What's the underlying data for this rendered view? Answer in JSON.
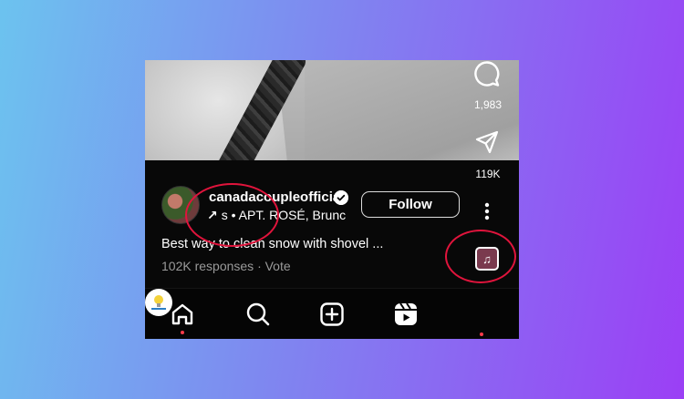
{
  "post": {
    "username": "canadacoupleofficial",
    "music": "s • APT. ROSÉ, Brunc",
    "follow_label": "Follow",
    "caption": "Best way to clean snow with shovel ...",
    "responses": "102K responses · Vote"
  },
  "rail": {
    "comments": "1,983",
    "shares": "119K"
  },
  "nav": {
    "items": [
      "home-icon",
      "search-icon",
      "create-icon",
      "reels-icon",
      "profile-avatar"
    ]
  },
  "colors": {
    "background_start": "#6cc3ef",
    "background_end": "#9b3ff5",
    "highlight_ring": "#e0143c",
    "notification_dot": "#ff3b4a"
  }
}
